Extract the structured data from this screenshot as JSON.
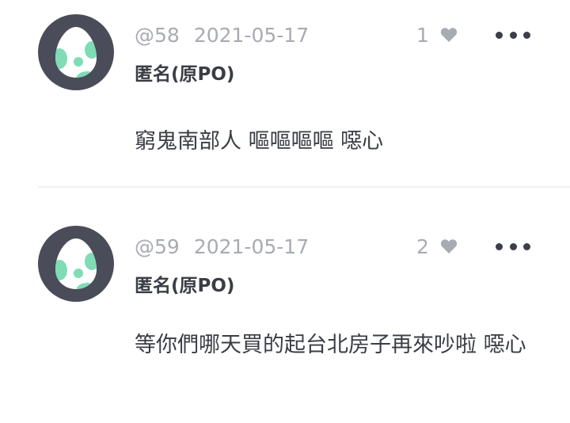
{
  "comments": [
    {
      "floor": "@58",
      "date": "2021-05-17",
      "likes": "1",
      "author": "匿名(原PO)",
      "content": "窮鬼南部人 嘔嘔嘔嘔 噁心",
      "avatar_icon": "egg-avatar-icon"
    },
    {
      "floor": "@59",
      "date": "2021-05-17",
      "likes": "2",
      "author": "匿名(原PO)",
      "content": "等你們哪天買的起台北房子再來吵啦 噁心",
      "avatar_icon": "egg-avatar-icon"
    }
  ],
  "colors": {
    "avatar_ring": "#4a4c59",
    "egg_spot": "#7fdcb4",
    "meta_text": "#a8abb2",
    "body_text": "#3a3d44",
    "heart": "#a8abb2",
    "more_dots": "#3b3e48"
  },
  "icons": {
    "like": "heart-icon",
    "more": "more-options-icon"
  }
}
